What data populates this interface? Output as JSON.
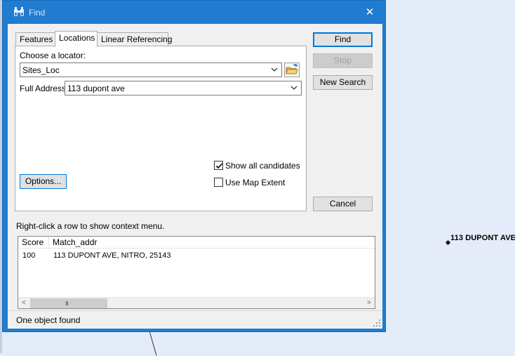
{
  "window": {
    "title": "Find",
    "close_glyph": "✕"
  },
  "tabs": [
    {
      "label": "Features",
      "active": false
    },
    {
      "label": "Locations",
      "active": true
    },
    {
      "label": "Linear Referencing",
      "active": false
    }
  ],
  "locations": {
    "locator_label": "Choose a locator:",
    "locator_value": "Sites_Loc",
    "address_label": "Full Address:",
    "address_value": "113 dupont ave",
    "show_all_candidates_label": "Show all candidates",
    "show_all_candidates_checked": true,
    "use_map_extent_label": "Use Map Extent",
    "use_map_extent_checked": false,
    "options_label": "Options..."
  },
  "buttons": {
    "find": "Find",
    "stop": "Stop",
    "new_search": "New Search",
    "cancel": "Cancel"
  },
  "hint": "Right-click a row to show context menu.",
  "results": {
    "columns": [
      "Score",
      "Match_addr"
    ],
    "rows": [
      {
        "score": "100",
        "match_addr": "113 DUPONT AVE, NITRO, 25143"
      }
    ],
    "scroll_left": "<",
    "scroll_right": ">",
    "scroll_grip": "III"
  },
  "status": "One object found",
  "map": {
    "point_label": "113 DUPONT AVE"
  },
  "icons": {
    "title": "binoculars-icon",
    "folder": "folder-open-icon",
    "dropdown": "chevron-down-icon",
    "checkbox": "check-icon",
    "sizegrip": "size-grip-icon"
  },
  "colors": {
    "titlebar": "#1f7cd0",
    "map_background": "#e4ecf9",
    "default_button_border": "#0078d7"
  }
}
